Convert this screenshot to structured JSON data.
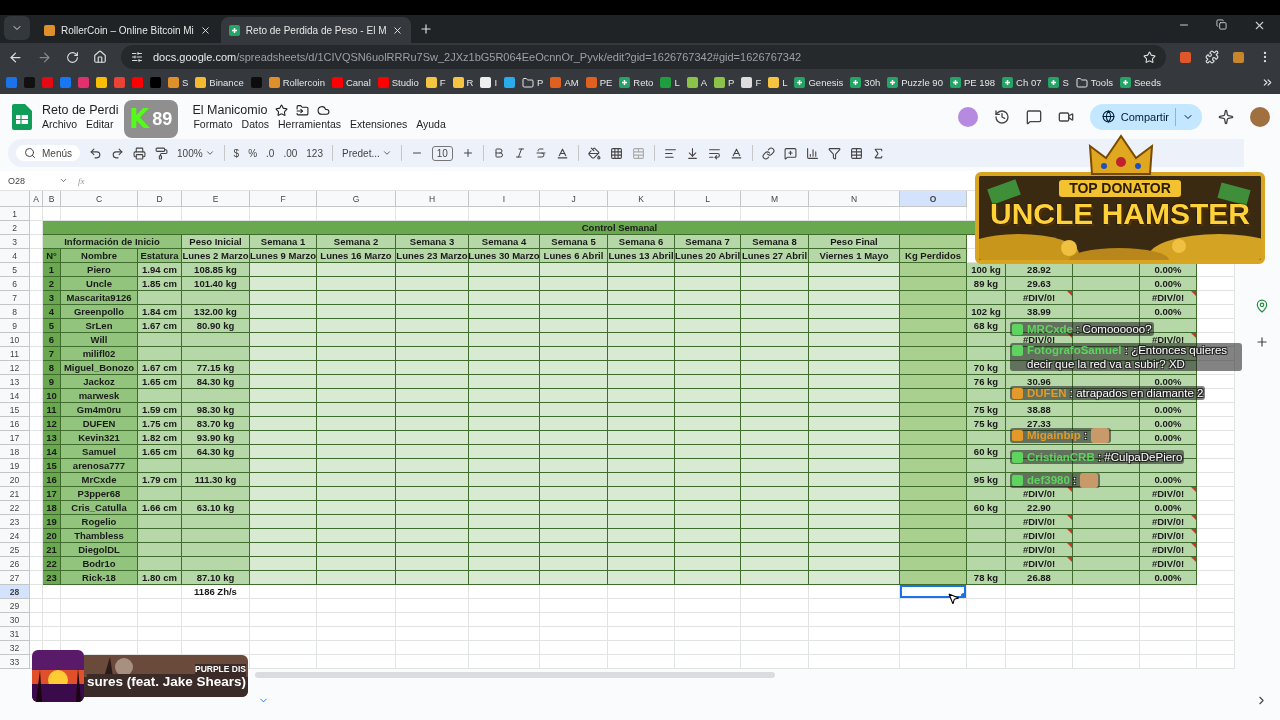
{
  "browser": {
    "tabs": [
      {
        "title": "RollerCoin – Online Bitcoin Mi",
        "selected": false
      },
      {
        "title": "Reto de Perdida de Peso - El M",
        "selected": true
      }
    ],
    "url_host": "docs.google.com",
    "url_path": "/spreadsheets/d/1CIVQSN6uolRRRu7Sw_2JXz1bG5R064EeOcnnOr_Pyvk/edit?gid=1626767342#gid=1626767342",
    "bookmarks": [
      {
        "kind": "site",
        "color": "#1a73e8"
      },
      {
        "kind": "site",
        "color": "#111111"
      },
      {
        "kind": "site",
        "color": "#e50914"
      },
      {
        "kind": "site",
        "color": "#1877f2"
      },
      {
        "kind": "site",
        "color": "#e1306c"
      },
      {
        "kind": "site",
        "color": "#fbbc04"
      },
      {
        "kind": "site",
        "color": "#ea4335"
      },
      {
        "kind": "site",
        "color": "#ff0000"
      },
      {
        "kind": "site",
        "color": "#000000"
      },
      {
        "kind": "site",
        "color": "#e0902a",
        "label": "S"
      },
      {
        "kind": "site",
        "color": "#f3ba2f",
        "label": "Binance"
      },
      {
        "kind": "site",
        "color": "#0d0d0d"
      },
      {
        "kind": "site",
        "color": "#e0902a",
        "label": "Rollercoin"
      },
      {
        "kind": "site",
        "color": "#ff0000",
        "label": "Canal"
      },
      {
        "kind": "site",
        "color": "#ff0000",
        "label": "Studio"
      },
      {
        "kind": "site",
        "color": "#f5c542",
        "label": "F"
      },
      {
        "kind": "site",
        "color": "#f5c542",
        "label": "R"
      },
      {
        "kind": "site",
        "color": "#eeeeee",
        "label": "I"
      },
      {
        "kind": "site",
        "color": "#2aabee"
      },
      {
        "kind": "folder",
        "label": "P"
      },
      {
        "kind": "site",
        "color": "#e06020",
        "label": "AM"
      },
      {
        "kind": "site",
        "color": "#e06020",
        "label": "PE"
      },
      {
        "kind": "sheet",
        "label": "Reto"
      },
      {
        "kind": "site",
        "color": "#1e9e3e",
        "label": "L"
      },
      {
        "kind": "site",
        "color": "#8bc34a",
        "label": "A"
      },
      {
        "kind": "site",
        "color": "#8bc34a",
        "label": "P"
      },
      {
        "kind": "site",
        "color": "#dddddd",
        "label": "F"
      },
      {
        "kind": "site",
        "color": "#f5c542",
        "label": "L"
      },
      {
        "kind": "sheet",
        "label": "Genesis"
      },
      {
        "kind": "sheet",
        "label": "30h"
      },
      {
        "kind": "sheet",
        "label": "Puzzle 90"
      },
      {
        "kind": "sheet",
        "label": "PE 198"
      },
      {
        "kind": "sheet",
        "label": "Ch 07"
      },
      {
        "kind": "sheet",
        "label": "S"
      },
      {
        "kind": "folder",
        "label": "Tools"
      },
      {
        "kind": "sheet",
        "label": "Seeds"
      }
    ]
  },
  "document": {
    "title_parts": [
      "Reto de Perdi",
      "El Manicomio"
    ],
    "menus": [
      "Archivo",
      "Editar",
      "Formato",
      "Datos",
      "Herramientas",
      "Extensiones",
      "Ayuda"
    ],
    "share": "Compartir"
  },
  "toolbar": {
    "search": "Menús",
    "zoom": "100%",
    "currency": "$",
    "percent": "%",
    "dec_less": ".0",
    "dec_more": ".00",
    "number_format": "123",
    "font": "Predet...",
    "font_size": "10"
  },
  "name_box": "O28",
  "formula_label": "fx",
  "column_headers": [
    {
      "label": "A",
      "selected": false
    },
    {
      "label": "B",
      "selected": false
    },
    {
      "label": "C",
      "selected": false
    },
    {
      "label": "D",
      "selected": false
    },
    {
      "label": "E",
      "selected": false
    },
    {
      "label": "F",
      "selected": false
    },
    {
      "label": "G",
      "selected": false
    },
    {
      "label": "H",
      "selected": false
    },
    {
      "label": "I",
      "selected": false
    },
    {
      "label": "J",
      "selected": false
    },
    {
      "label": "K",
      "selected": false
    },
    {
      "label": "L",
      "selected": false
    },
    {
      "label": "M",
      "selected": false
    },
    {
      "label": "N",
      "selected": false
    },
    {
      "label": "O",
      "selected": true
    }
  ],
  "row_numbers": [
    {
      "label": "1",
      "selected": false
    },
    {
      "label": "2",
      "selected": false
    },
    {
      "label": "3",
      "selected": false
    },
    {
      "label": "4",
      "selected": false
    },
    {
      "label": "5",
      "selected": false
    },
    {
      "label": "6",
      "selected": false
    },
    {
      "label": "7",
      "selected": false
    },
    {
      "label": "8",
      "selected": false
    },
    {
      "label": "9",
      "selected": false
    },
    {
      "label": "10",
      "selected": false
    },
    {
      "label": "11",
      "selected": false
    },
    {
      "label": "12",
      "selected": false
    },
    {
      "label": "13",
      "selected": false
    },
    {
      "label": "14",
      "selected": false
    },
    {
      "label": "15",
      "selected": false
    },
    {
      "label": "16",
      "selected": false
    },
    {
      "label": "17",
      "selected": false
    },
    {
      "label": "18",
      "selected": false
    },
    {
      "label": "19",
      "selected": false
    },
    {
      "label": "20",
      "selected": false
    },
    {
      "label": "21",
      "selected": false
    },
    {
      "label": "22",
      "selected": false
    },
    {
      "label": "23",
      "selected": false
    },
    {
      "label": "24",
      "selected": false
    },
    {
      "label": "25",
      "selected": false
    },
    {
      "label": "26",
      "selected": false
    },
    {
      "label": "27",
      "selected": false
    },
    {
      "label": "28",
      "selected": true
    },
    {
      "label": "29",
      "selected": false
    },
    {
      "label": "30",
      "selected": false
    },
    {
      "label": "31",
      "selected": false
    },
    {
      "label": "32",
      "selected": false
    },
    {
      "label": "33",
      "selected": false
    }
  ],
  "table": {
    "title": "Control Semanal",
    "group_headers": [
      "Información de Inicio",
      "Peso Inicial",
      "Semana 1",
      "Semana 2",
      "Semana 3",
      "Semana 4",
      "Semana 5",
      "Semana 6",
      "Semana 7",
      "Semana 8",
      "Peso Final"
    ],
    "column_titles": [
      "N°",
      "Nombre",
      "Estatura",
      "Lunes 2 Marzo",
      "Lunes 9 Marzo",
      "Lunes 16 Marzo",
      "Lunes 23 Marzo",
      "Lunes 30 Marzo",
      "Lunes 6 Abril",
      "Lunes 13 Abril",
      "Lunes 20 Abril",
      "Lunes 27 Abril",
      "Viernes 1 Mayo",
      "Kg Perdidos"
    ],
    "rows": [
      {
        "n": "1",
        "name": "Piero",
        "height": "1.94 cm",
        "weight": "108.85 kg",
        "final": "100 kg",
        "imc": "28.92",
        "percent": "0.00%"
      },
      {
        "n": "2",
        "name": "Uncle",
        "height": "1.85 cm",
        "weight": "101.40 kg",
        "final": "89 kg",
        "imc": "29.63",
        "percent": "0.00%"
      },
      {
        "n": "3",
        "name": "Mascarita9126",
        "imc": "#DIV/0!",
        "percent": "#DIV/0!",
        "error": true
      },
      {
        "n": "4",
        "name": "Greenpollo",
        "height": "1.84 cm",
        "weight": "132.00 kg",
        "final": "102 kg",
        "imc": "38.99",
        "percent": "0.00%"
      },
      {
        "n": "5",
        "name": "SrLen",
        "height": "1.67 cm",
        "weight": "80.90 kg",
        "final": "68 kg"
      },
      {
        "n": "6",
        "name": "Will",
        "imc": "#DIV/0!",
        "percent": "#DIV/0!",
        "error": true
      },
      {
        "n": "7",
        "name": "milifl02"
      },
      {
        "n": "8",
        "name": "Miguel_Bonozo",
        "height": "1.67 cm",
        "weight": "77.15 kg",
        "final": "70 kg"
      },
      {
        "n": "9",
        "name": "Jackoz",
        "height": "1.65 cm",
        "weight": "84.30 kg",
        "final": "76 kg",
        "imc": "30.96",
        "percent": "0.00%"
      },
      {
        "n": "10",
        "name": "marwesk"
      },
      {
        "n": "11",
        "name": "Gm4m0ru",
        "height": "1.59 cm",
        "weight": "98.30 kg",
        "final": "75 kg",
        "imc": "38.88",
        "percent": "0.00%"
      },
      {
        "n": "12",
        "name": "DUFEN",
        "height": "1.75 cm",
        "weight": "83.70 kg",
        "final": "75 kg",
        "imc": "27.33",
        "percent": "0.00%"
      },
      {
        "n": "13",
        "name": "Kevin321",
        "height": "1.82 cm",
        "weight": "93.90 kg",
        "percent": "0.00%"
      },
      {
        "n": "14",
        "name": "Samuel",
        "height": "1.65 cm",
        "weight": "64.30 kg",
        "final": "60 kg"
      },
      {
        "n": "15",
        "name": "arenosa777"
      },
      {
        "n": "16",
        "name": "MrCxde",
        "height": "1.79 cm",
        "weight": "111.30 kg",
        "final": "95 kg",
        "percent": "0.00%"
      },
      {
        "n": "17",
        "name": "P3pper68",
        "imc": "#DIV/0!",
        "percent": "#DIV/0!",
        "error": true
      },
      {
        "n": "18",
        "name": "Cris_Catulla",
        "height": "1.66 cm",
        "weight": "63.10 kg",
        "final": "60 kg",
        "imc": "22.90",
        "percent": "0.00%"
      },
      {
        "n": "19",
        "name": "Rogelio",
        "imc": "#DIV/0!",
        "percent": "#DIV/0!",
        "error": true
      },
      {
        "n": "20",
        "name": "Thambless",
        "imc": "#DIV/0!",
        "percent": "#DIV/0!",
        "error": true
      },
      {
        "n": "21",
        "name": "DiegolDL",
        "imc": "#DIV/0!",
        "percent": "#DIV/0!",
        "error": true
      },
      {
        "n": "22",
        "name": "Bodr1o",
        "imc": "#DIV/0!",
        "percent": "#DIV/0!",
        "error": true
      },
      {
        "n": "23",
        "name": "Rick-18",
        "height": "1.80 cm",
        "weight": "87.10 kg",
        "final": "78 kg",
        "imc": "26.88",
        "percent": "0.00%"
      }
    ],
    "total": "1186 Zh/s"
  },
  "stream_overlay": {
    "badge_logo": "K",
    "badge_count": "89",
    "banner": {
      "line_1": "TOP DONATOR",
      "line_2": "UNCLE HAMSTER"
    },
    "chat": [
      {
        "user": "MRCxde",
        "text": ": Comoooooo?",
        "color": "#5fd35f",
        "emote": false
      },
      {
        "user": "FotografoSamuel",
        "text": ": ¿Entonces quieres decir que la red va a subir? XD",
        "color": "#5fd35f",
        "emote": false
      },
      {
        "user": "DUFEN",
        "text": ": atrapados en diamante 2",
        "color": "#e39a2a",
        "emote": false
      },
      {
        "user": "Migainbip",
        "text": ":",
        "color": "#e39a2a",
        "emote": true
      },
      {
        "user": "CristianCRB",
        "text": ": #CulpaDePiero",
        "color": "#5fd35f",
        "emote": false
      },
      {
        "user": "def3980",
        "text": ":",
        "color": "#5fd35f",
        "emote": true
      }
    ],
    "music": {
      "artist": "PURPLE DIS",
      "track": "sures (feat. Jake Shears)"
    }
  }
}
